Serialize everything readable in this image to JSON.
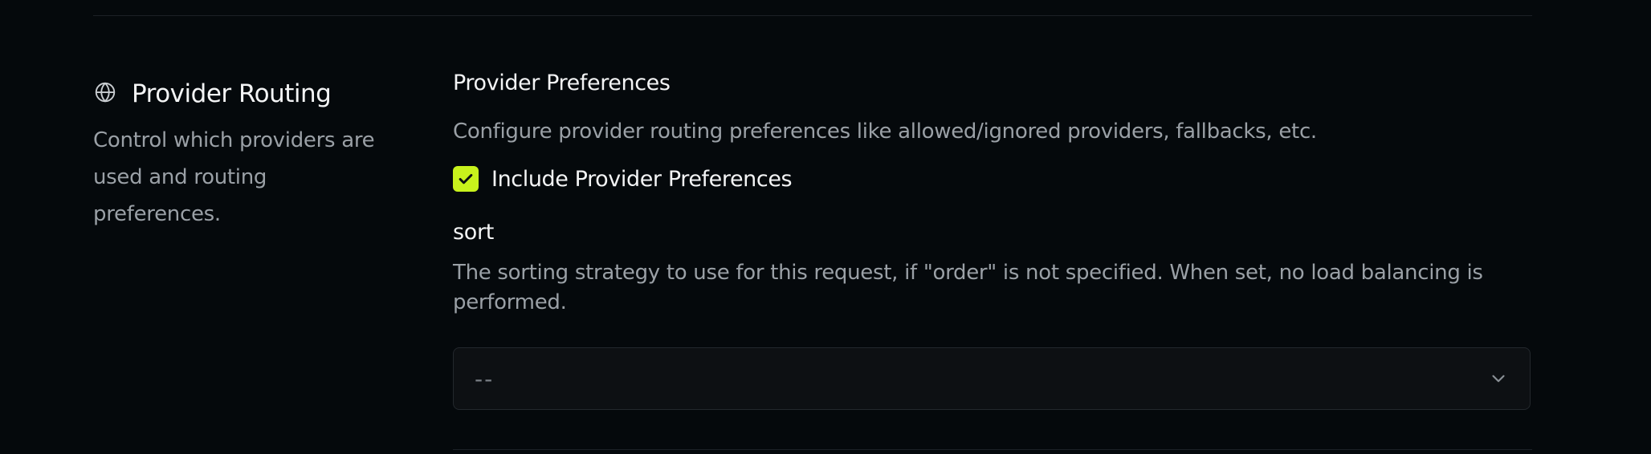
{
  "section": {
    "icon": "globe-icon",
    "title": "Provider Routing",
    "description": "Control which providers are used and routing preferences."
  },
  "preferences": {
    "title": "Provider Preferences",
    "description": "Configure provider routing preferences like allowed/ignored providers, fallbacks, etc.",
    "include_checkbox": {
      "label": "Include Provider Preferences",
      "checked": true
    }
  },
  "sort": {
    "label": "sort",
    "description": "The sorting strategy to use for this request, if \"order\" is not specified. When set, no load balancing is performed.",
    "selected_value": "--",
    "icon": "chevron-down-icon"
  },
  "colors": {
    "background": "#05090c",
    "accent": "#c8f21c",
    "text_primary": "#f3f4f5",
    "text_secondary": "#9aa0a6",
    "input_bg": "#0d1013",
    "border": "#23282d"
  }
}
